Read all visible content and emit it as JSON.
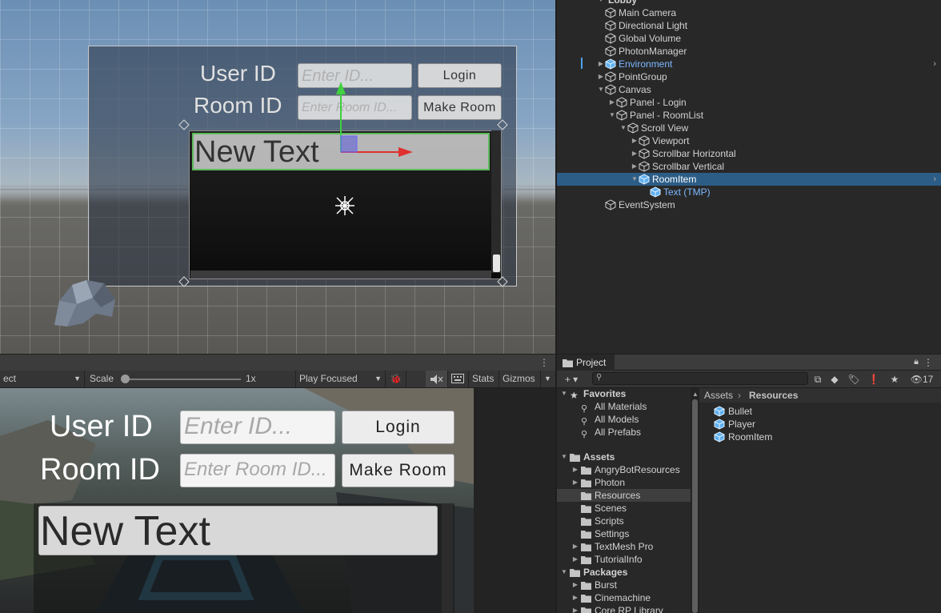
{
  "scene": {
    "canvas": {
      "user_label": "User ID",
      "room_label": "Room ID",
      "user_placeholder": "Enter ID...",
      "room_placeholder": "Enter Room ID...",
      "login_label": "Login",
      "make_room_label": "Make Room",
      "item_text": "New Text"
    }
  },
  "hierarchy": {
    "root": "Lobby",
    "items": [
      {
        "label": "Main Camera",
        "depth": 0,
        "arrow": ""
      },
      {
        "label": "Directional Light",
        "depth": 0,
        "arrow": ""
      },
      {
        "label": "Global Volume",
        "depth": 0,
        "arrow": ""
      },
      {
        "label": "PhotonManager",
        "depth": 0,
        "arrow": ""
      },
      {
        "label": "Environment",
        "depth": 0,
        "arrow": "collapsed",
        "prefab": true
      },
      {
        "label": "PointGroup",
        "depth": 0,
        "arrow": "collapsed"
      },
      {
        "label": "Canvas",
        "depth": 0,
        "arrow": "expanded"
      },
      {
        "label": "Panel - Login",
        "depth": 1,
        "arrow": "collapsed"
      },
      {
        "label": "Panel - RoomList",
        "depth": 1,
        "arrow": "expanded"
      },
      {
        "label": "Scroll View",
        "depth": 2,
        "arrow": "expanded"
      },
      {
        "label": "Viewport",
        "depth": 3,
        "arrow": "collapsed"
      },
      {
        "label": "Scrollbar Horizontal",
        "depth": 3,
        "arrow": "collapsed"
      },
      {
        "label": "Scrollbar Vertical",
        "depth": 3,
        "arrow": "collapsed"
      },
      {
        "label": "RoomItem",
        "depth": 3,
        "arrow": "expanded",
        "selected": true,
        "prefab": true
      },
      {
        "label": "Text (TMP)",
        "depth": 4,
        "arrow": "",
        "prefab": true
      },
      {
        "label": "EventSystem",
        "depth": 0,
        "arrow": ""
      }
    ]
  },
  "game": {
    "toolbar": {
      "display_partial": "ect",
      "scale_label": "Scale",
      "scale_value": "1x",
      "scale_fraction": 0.0,
      "play_mode": "Play Focused",
      "stats_label": "Stats",
      "gizmos_label": "Gizmos"
    },
    "canvas": {
      "user_label": "User ID",
      "room_label": "Room ID",
      "user_placeholder": "Enter ID...",
      "room_placeholder": "Enter Room ID...",
      "login_label": "Login",
      "make_room_label": "Make Room",
      "item_text": "New Text"
    }
  },
  "project": {
    "tab_label": "Project",
    "hidden_count": "17",
    "breadcrumb": [
      "Assets",
      "Resources"
    ],
    "favorites": {
      "label": "Favorites",
      "items": [
        "All Materials",
        "All Models",
        "All Prefabs"
      ]
    },
    "assets": {
      "label": "Assets",
      "items": [
        {
          "label": "AngryBotResources",
          "arrow": true
        },
        {
          "label": "Photon",
          "arrow": true
        },
        {
          "label": "Resources",
          "arrow": false,
          "selected": true
        },
        {
          "label": "Scenes",
          "arrow": false
        },
        {
          "label": "Scripts",
          "arrow": false
        },
        {
          "label": "Settings",
          "arrow": false
        },
        {
          "label": "TextMesh Pro",
          "arrow": true
        },
        {
          "label": "TutorialInfo",
          "arrow": true
        }
      ]
    },
    "packages": {
      "label": "Packages",
      "items": [
        "Burst",
        "Cinemachine",
        "Core RP Library"
      ]
    },
    "resources": [
      "Bullet",
      "Player",
      "RoomItem"
    ]
  },
  "colors": {
    "selection": "#2c5d87",
    "prefab_blue": "#7cb8ff",
    "prefab_cube": "#5fb0f0",
    "x_axis": "#e03030",
    "y_axis": "#40d040"
  }
}
